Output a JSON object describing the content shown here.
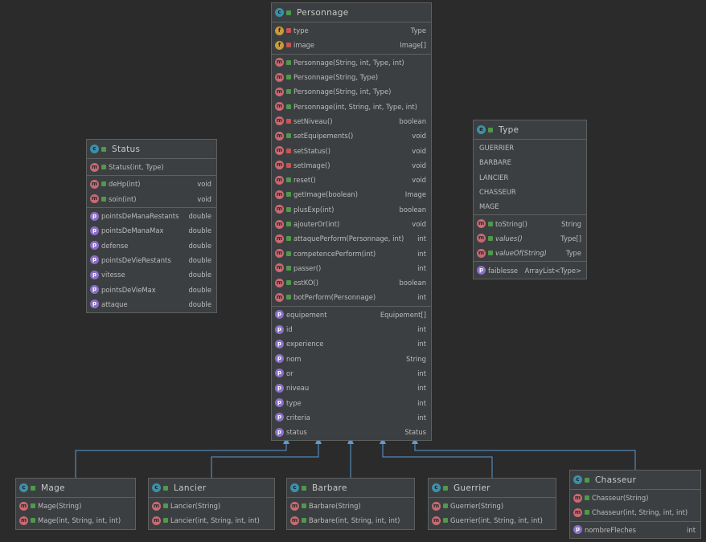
{
  "classes": {
    "personnage": {
      "name": "Personnage",
      "fields": [
        {
          "name": "type",
          "type": "Type"
        },
        {
          "name": "image",
          "type": "Image[]"
        }
      ],
      "methods": [
        {
          "name": "Personnage(String, int, Type, int)",
          "type": ""
        },
        {
          "name": "Personnage(String, Type)",
          "type": ""
        },
        {
          "name": "Personnage(String, int, Type)",
          "type": ""
        },
        {
          "name": "Personnage(int, String, int, Type, int)",
          "type": ""
        },
        {
          "name": "setNiveau()",
          "type": "boolean"
        },
        {
          "name": "setEquipements()",
          "type": "void"
        },
        {
          "name": "setStatus()",
          "type": "void"
        },
        {
          "name": "setImage()",
          "type": "void"
        },
        {
          "name": "reset()",
          "type": "void"
        },
        {
          "name": "getImage(boolean)",
          "type": "Image"
        },
        {
          "name": "plusExp(int)",
          "type": "boolean"
        },
        {
          "name": "ajouterOr(int)",
          "type": "void"
        },
        {
          "name": "attaquePerform(Personnage, int)",
          "type": "int"
        },
        {
          "name": "competencePerform(int)",
          "type": "int"
        },
        {
          "name": "passer()",
          "type": "int"
        },
        {
          "name": "estKO()",
          "type": "boolean"
        },
        {
          "name": "botPerform(Personnage)",
          "type": "int"
        }
      ],
      "properties": [
        {
          "name": "equipement",
          "type": "Equipement[]"
        },
        {
          "name": "id",
          "type": "int"
        },
        {
          "name": "experience",
          "type": "int"
        },
        {
          "name": "nom",
          "type": "String"
        },
        {
          "name": "or",
          "type": "int"
        },
        {
          "name": "niveau",
          "type": "int"
        },
        {
          "name": "type",
          "type": "int"
        },
        {
          "name": "criteria",
          "type": "int"
        },
        {
          "name": "status",
          "type": "Status"
        }
      ]
    },
    "status": {
      "name": "Status",
      "constructors": [
        {
          "name": "Status(int, Type)",
          "type": ""
        }
      ],
      "methods": [
        {
          "name": "deHp(int)",
          "type": "void"
        },
        {
          "name": "soin(int)",
          "type": "void"
        }
      ],
      "properties": [
        {
          "name": "pointsDeManaRestants",
          "type": "double"
        },
        {
          "name": "pointsDeManaMax",
          "type": "double"
        },
        {
          "name": "defense",
          "type": "double"
        },
        {
          "name": "pointsDeVieRestants",
          "type": "double"
        },
        {
          "name": "vitesse",
          "type": "double"
        },
        {
          "name": "pointsDeVieMax",
          "type": "double"
        },
        {
          "name": "attaque",
          "type": "double"
        }
      ]
    },
    "type": {
      "name": "Type",
      "constants": [
        "GUERRIER",
        "BARBARE",
        "LANCIER",
        "CHASSEUR",
        "MAGE"
      ],
      "methods": [
        {
          "name": "toString()",
          "type": "String"
        },
        {
          "name": "values()",
          "type": "Type[]"
        },
        {
          "name": "valueOf(String)",
          "type": "Type"
        }
      ],
      "properties": [
        {
          "name": "faiblesse",
          "type": "ArrayList<Type>"
        }
      ]
    },
    "mage": {
      "name": "Mage",
      "methods": [
        {
          "name": "Mage(String)",
          "type": ""
        },
        {
          "name": "Mage(int, String, int, int)",
          "type": ""
        }
      ]
    },
    "lancier": {
      "name": "Lancier",
      "methods": [
        {
          "name": "Lancier(String)",
          "type": ""
        },
        {
          "name": "Lancier(int, String, int, int)",
          "type": ""
        }
      ]
    },
    "barbare": {
      "name": "Barbare",
      "methods": [
        {
          "name": "Barbare(String)",
          "type": ""
        },
        {
          "name": "Barbare(int, String, int, int)",
          "type": ""
        }
      ]
    },
    "guerrier": {
      "name": "Guerrier",
      "methods": [
        {
          "name": "Guerrier(String)",
          "type": ""
        },
        {
          "name": "Guerrier(int, String, int, int)",
          "type": ""
        }
      ]
    },
    "chasseur": {
      "name": "Chasseur",
      "methods": [
        {
          "name": "Chasseur(String)",
          "type": ""
        },
        {
          "name": "Chasseur(int, String, int, int)",
          "type": ""
        }
      ],
      "properties": [
        {
          "name": "nombreFleches",
          "type": "int"
        }
      ]
    }
  },
  "colors": {
    "background": "#2b2b2b",
    "box": "#3c3f41",
    "border": "#5e6060",
    "inheritance_edge": "#5b9bd5"
  }
}
